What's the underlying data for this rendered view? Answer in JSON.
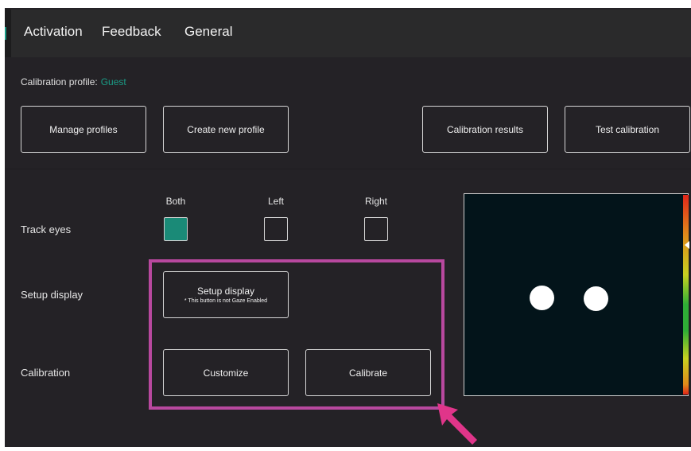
{
  "tabs": [
    {
      "label": "Activation"
    },
    {
      "label": "Feedback"
    },
    {
      "label": "General"
    }
  ],
  "profile": {
    "label": "Calibration profile:",
    "name": "Guest"
  },
  "buttons": {
    "manage_profiles": "Manage profiles",
    "create_profile": "Create new profile",
    "calibration_results": "Calibration results",
    "test_calibration": "Test calibration",
    "setup_display": "Setup display",
    "setup_display_note": "* This button is not Gaze Enabled",
    "customize": "Customize",
    "calibrate": "Calibrate"
  },
  "rows": {
    "track_eyes": "Track eyes",
    "setup_display": "Setup display",
    "calibration": "Calibration"
  },
  "eye_options": [
    {
      "label": "Both",
      "checked": true
    },
    {
      "label": "Left",
      "checked": false
    },
    {
      "label": "Right",
      "checked": false
    }
  ],
  "colors": {
    "accent": "#1a9c86",
    "background": "#242226",
    "highlight": "#b8489e",
    "arrow": "#e0358a",
    "display_panel": "#03141a"
  },
  "icons": {
    "annotation_arrow": "arrow-up-left-icon",
    "meter_pointer": "caret-left-icon"
  }
}
